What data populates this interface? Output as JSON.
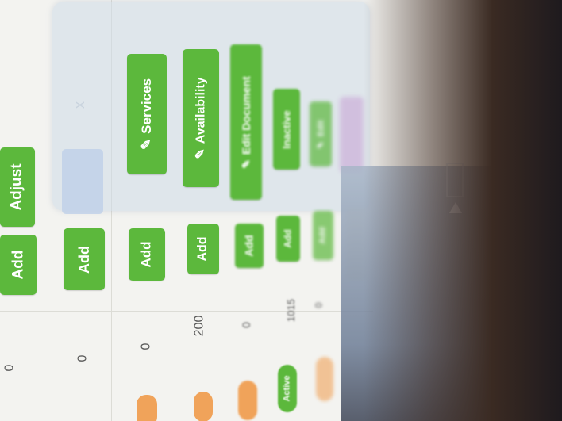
{
  "table": {
    "rows": [
      {
        "qty": "0",
        "add_label": "Add",
        "adjust_label": "Adjust"
      },
      {
        "qty": "0",
        "add_label": "Add"
      },
      {
        "qty": "0",
        "add_label": "Add"
      },
      {
        "qty": "200",
        "add_label": "Add"
      },
      {
        "qty": "0",
        "add_label": "Add"
      },
      {
        "qty": "1015",
        "add_label": "Add",
        "status": "Active"
      },
      {
        "qty": "0",
        "add_label": "Add"
      }
    ]
  },
  "popup": {
    "close_label": "x",
    "actions": [
      {
        "label": "Services"
      },
      {
        "label": "Availability"
      },
      {
        "label": "Edit Document"
      },
      {
        "label": "Inactive"
      },
      {
        "label": "Edit"
      }
    ]
  },
  "colors": {
    "green": "#5cb83c",
    "active_badge": "#5cb83c",
    "orange_badge": "#f0a35a"
  },
  "icons": [
    "pencil-icon",
    "close-icon",
    "triangle-up-icon"
  ]
}
